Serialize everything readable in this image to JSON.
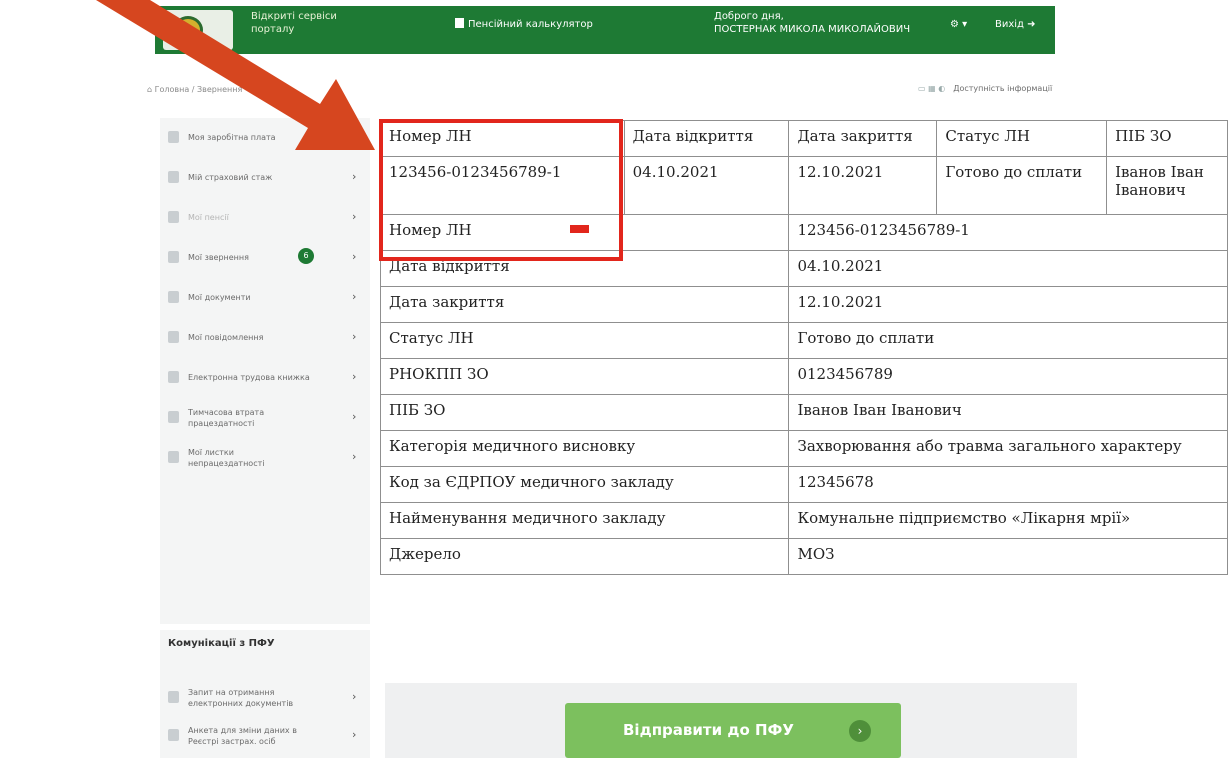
{
  "header": {
    "services": "Відкриті сервіси порталу",
    "calculator": "Пенсійний калькулятор",
    "greeting": "Доброго дня,",
    "user_name": "ПОСТЕРНАК МИКОЛА МИКОЛАЙОВИЧ",
    "settings": "⚙ ▾",
    "logout": "Вихід ➜"
  },
  "breadcrumb": "⌂ Головна / Звернення",
  "accessibility": {
    "icons": "▭ ▦ ◐",
    "label": "Доступність інформації"
  },
  "sidebar": {
    "items": [
      {
        "label": "Моя заробітна плата"
      },
      {
        "label": "Мій страховий стаж"
      },
      {
        "label": "Мої пенсії"
      },
      {
        "label": "Мої звернення",
        "badge": "6"
      },
      {
        "label": "Мої документи"
      },
      {
        "label": "Мої повідомлення"
      },
      {
        "label": "Електронна трудова книжка"
      },
      {
        "label": "Тимчасова втрата працездатності"
      },
      {
        "label": "Мої листки непрацездатності"
      },
      {
        "label": "Запит на отримання електронних документів"
      },
      {
        "label": "Анкета для зміни даних в Реєстрі застрах. осіб"
      }
    ],
    "section_title": "Комунікації з ПФУ",
    "chevron": "›"
  },
  "table": {
    "headers": [
      "Номер ЛН",
      "Дата відкриття",
      "Дата закриття",
      "Статус ЛН",
      "ПІБ ЗО"
    ],
    "first_row": [
      "123456-0123456789-1",
      "04.10.2021",
      "12.10.2021",
      "Готово до сплати",
      "Іванов Іван Іванович"
    ],
    "details": [
      {
        "label": "Номер ЛН",
        "value": "123456-0123456789-1"
      },
      {
        "label": "Дата відкриття",
        "value": "04.10.2021"
      },
      {
        "label": "Дата закриття",
        "value": "12.10.2021"
      },
      {
        "label": "Статус ЛН",
        "value": "Готово до сплати"
      },
      {
        "label": "РНОКПП ЗО",
        "value": "0123456789"
      },
      {
        "label": "ПІБ ЗО",
        "value": "Іванов Іван Іванович"
      },
      {
        "label": "Категорія медичного висновку",
        "value": "Захворювання або травма загального характеру"
      },
      {
        "label": "Код за ЄДРПОУ медичного закладу",
        "value": "12345678"
      },
      {
        "label": "Найменування медичного закладу",
        "value": "Комунальне підприємство «Лікарня мрії»"
      },
      {
        "label": "Джерело",
        "value": "МОЗ"
      }
    ]
  },
  "send_button": {
    "label": "Відправити до ПФУ",
    "icon": "›"
  },
  "colors": {
    "header_green": "#1e7a34",
    "button_green": "#7cc05e",
    "annotation_red": "#e2261c",
    "arrow_fill": "#d6461f"
  }
}
